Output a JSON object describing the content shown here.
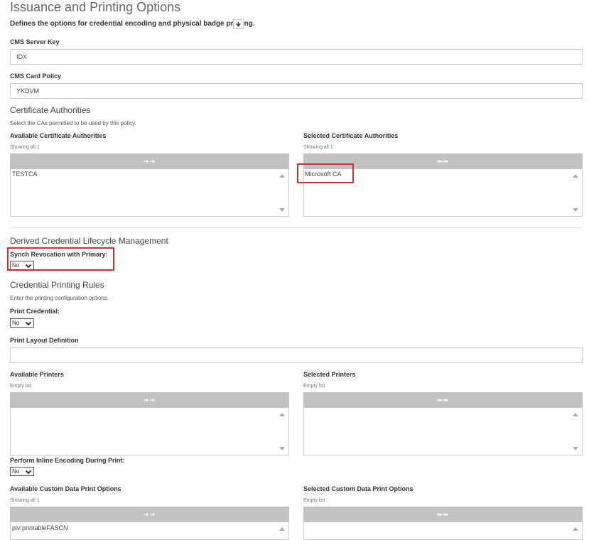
{
  "page": {
    "title": "Issuance and Printing Options",
    "subtitle": "Defines the options for credential encoding and physical badge printing.",
    "help_icon": "download-arrow-icon",
    "help_glyph": "🡻"
  },
  "cms_server_key": {
    "label": "CMS Server Key",
    "value": "IDX"
  },
  "cms_card_policy": {
    "label": "CMS Card Policy",
    "value": "YKDVM"
  },
  "cert_authorities": {
    "heading": "Certificate Authorities",
    "description": "Select the CAs permitted to be used by this policy.",
    "available": {
      "label": "Available Certificate Authorities",
      "count_text": "Showing all 1",
      "move_glyph": "➔➔",
      "items": [
        "TESTCA"
      ]
    },
    "selected": {
      "label": "Selected Certificate Authorities",
      "count_text": "Showing all 1",
      "move_glyph": "⬅⬅",
      "items": [
        "Microsoft CA"
      ]
    }
  },
  "derived_credential": {
    "heading": "Derived Credential Lifecycle Management",
    "synch_label": "Synch Revocation with Primary:",
    "synch_value": "No"
  },
  "printing_rules": {
    "heading": "Credential Printing Rules",
    "description": "Enter the printing configuration options.",
    "print_credential_label": "Print Credential:",
    "print_credential_value": "No",
    "layout_label": "Print Layout Definition",
    "layout_value": ""
  },
  "printers": {
    "available": {
      "label": "Available Printers",
      "count_text": "Empty list",
      "move_glyph": "➔➔"
    },
    "selected": {
      "label": "Selected Printers",
      "count_text": "Empty list",
      "move_glyph": "⬅⬅"
    }
  },
  "inline_encoding": {
    "label": "Perform Inline Encoding During Print:",
    "value": "No"
  },
  "custom_data": {
    "available": {
      "label": "Available Custom Data Print Options",
      "count_text": "Showing all 1",
      "move_glyph": "➔➔",
      "items": [
        "piv:printableFASCN"
      ]
    },
    "selected": {
      "label": "Selected Custom Data Print Options",
      "count_text": "Empty list",
      "move_glyph": "⬅⬅"
    }
  },
  "colors": {
    "highlight": "#d32f2f",
    "move_bar": "#c2c2c2"
  }
}
